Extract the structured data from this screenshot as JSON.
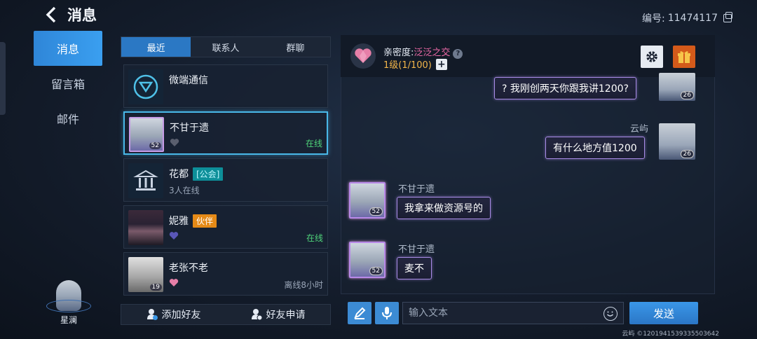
{
  "header": {
    "title": "消息",
    "uid_label": "编号:",
    "uid_value": "11474117"
  },
  "side_nav": {
    "items": [
      {
        "label": "消息",
        "active": true
      },
      {
        "label": "留言箱",
        "active": false
      },
      {
        "label": "邮件",
        "active": false
      }
    ]
  },
  "user": {
    "name": "星澜"
  },
  "tabs": [
    {
      "label": "最近",
      "active": true
    },
    {
      "label": "联系人",
      "active": false
    },
    {
      "label": "群聊",
      "active": false
    }
  ],
  "contacts": [
    {
      "name": "微端通信",
      "sub": "",
      "tag": "",
      "status": "",
      "level": ""
    },
    {
      "name": "不甘于遗",
      "sub": "",
      "tag": "",
      "status": "在线",
      "level": "52"
    },
    {
      "name": "花都",
      "sub": "3人在线",
      "tag": "[公会]",
      "status": "",
      "level": ""
    },
    {
      "name": "妮雅",
      "sub": "",
      "tag": "伙伴",
      "status": "在线",
      "level": ""
    },
    {
      "name": "老张不老",
      "sub": "",
      "tag": "",
      "status": "离线8小时",
      "level": "19"
    }
  ],
  "actions": {
    "add_friend": "添加好友",
    "friend_request": "好友申请"
  },
  "chat": {
    "intimacy_label": "亲密度:",
    "intimacy_value": "泛泛之交",
    "intimacy_level": "1级(1/100)",
    "messages": [
      {
        "sender": "",
        "text": "? 我刚创两天你跟我讲1200?",
        "mine": true,
        "level": "26"
      },
      {
        "sender": "云屿",
        "text": "有什么地方值1200",
        "mine": true,
        "level": "26"
      },
      {
        "sender": "不甘于遗",
        "text": "我拿来做资源号的",
        "mine": false,
        "level": "52"
      },
      {
        "sender": "不甘于遗",
        "text": "麦不",
        "mine": false,
        "level": "52"
      }
    ],
    "input_placeholder": "输入文本",
    "send_label": "发送"
  },
  "footer": {
    "text": "云屿 ©1201941539335503642"
  },
  "colors": {
    "accent": "#3a97e8",
    "online": "#4fd47a",
    "intimacy": "#ef6aa8",
    "partner_tag": "#e58a17",
    "guild_tag": "#0d8f99"
  }
}
